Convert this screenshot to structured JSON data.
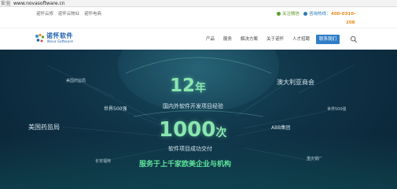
{
  "browser": {
    "security_label": "安全",
    "url": "www.novasoftware.cn"
  },
  "topbar": {
    "links": [
      "诺怀云修",
      "诺怀云物业",
      "诺怀电商"
    ],
    "wechat_label": "关注微信",
    "hotline_label": "咨询热线：",
    "hotline_number_1": "400-0310-",
    "hotline_number_2": "208"
  },
  "header": {
    "logo_cn": "诺怀软件",
    "logo_en": "Nova Software",
    "nav": [
      {
        "label": "产品",
        "active": false
      },
      {
        "label": "服务",
        "active": false
      },
      {
        "label": "解决方案",
        "active": false
      },
      {
        "label": "关于诺怀",
        "active": false
      },
      {
        "label": "人才招聘",
        "active": false
      },
      {
        "label": "联系我们",
        "active": true
      }
    ],
    "search_icon": "search-icon"
  },
  "hero": {
    "stat1_value": "12",
    "stat1_unit": "年",
    "stat1_caption": "国内外软件开发项目经验",
    "stat2_value": "1000",
    "stat2_unit": "次",
    "stat2_caption": "软件项目成功交付",
    "slogan": "服务于上千家欧美企业与机构",
    "clients": {
      "fda_small": "美国药监局",
      "fortune500_left": "世界500强",
      "fda_large": "美国药监局",
      "changan": "长安福特",
      "australia_chamber": "澳大利亚商会",
      "fortune500_right": "世界500强",
      "abb": "ABB集团",
      "chongqing": "重庆钢厂"
    },
    "accent_color": "#8ae6b0",
    "slogan_color": "#5fe29a",
    "bg_color": "#0f3246"
  },
  "colors": {
    "brand_blue": "#1f5fae",
    "nav_active": "#2f7ec7",
    "hotline_orange": "#e8891c",
    "wechat_green": "#5aa02c"
  }
}
